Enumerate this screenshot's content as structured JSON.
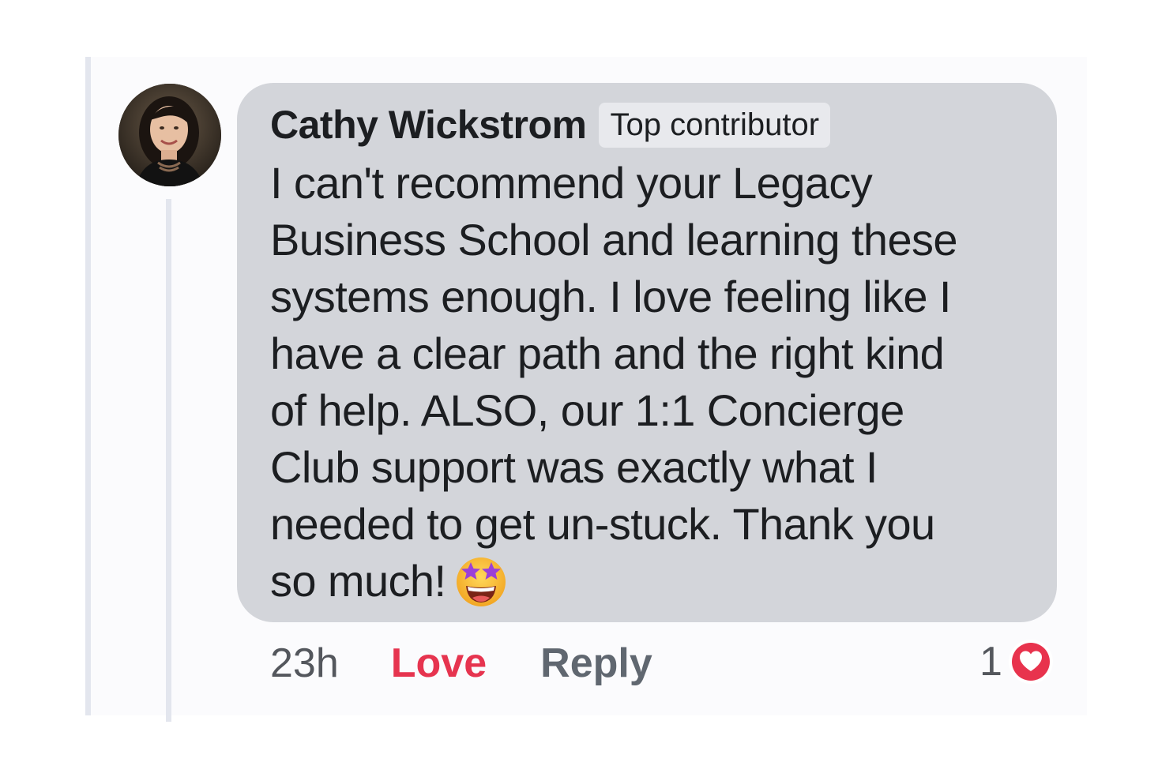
{
  "comment": {
    "author": "Cathy Wickstrom",
    "badge": "Top contributor",
    "lines": [
      "I can't recommend your Legacy",
      "Business School and learning these",
      "systems enough. I love feeling like I",
      "have a clear path and the right kind",
      "of help. ALSO, our 1:1 Concierge",
      "Club support was exactly what I",
      "needed to get un-stuck. Thank you",
      "so much!"
    ],
    "emoji": "star-struck-emoji"
  },
  "actions": {
    "time": "23h",
    "love": "Love",
    "reply": "Reply"
  },
  "reactions": {
    "count": "1",
    "icon": "heart-icon"
  },
  "colors": {
    "bubble": "#d3d5da",
    "love": "#e6344f",
    "heart": "#e8334d",
    "thread_line": "#e3e6ee"
  }
}
